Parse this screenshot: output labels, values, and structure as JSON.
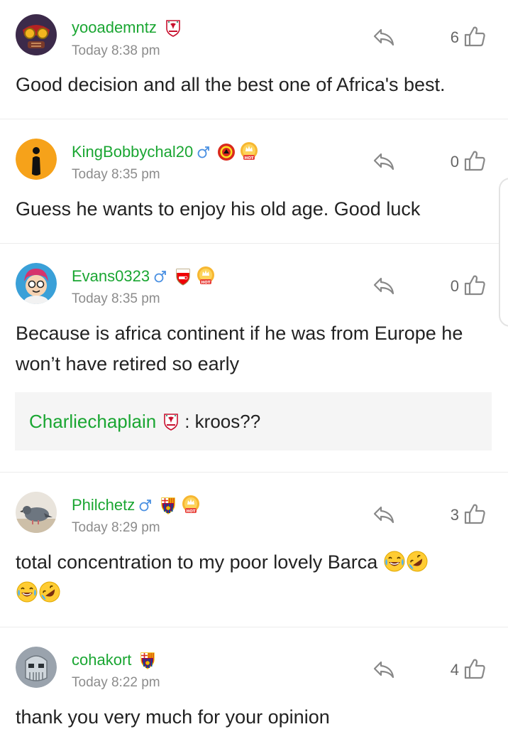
{
  "comments": [
    {
      "username": "yooademntz",
      "time": "Today 8:38 pm",
      "likes": "6",
      "text": "Good decision and all the best one of Africa's best.",
      "club_badge": "liverpool-badge-icon",
      "gender": null,
      "hot": false
    },
    {
      "username": "KingBobbychal20",
      "time": "Today 8:35 pm",
      "likes": "0",
      "text": "Guess he wants to enjoy his old age. Good luck",
      "club_badge": "manchester-united-badge-icon",
      "gender": "male",
      "hot": true
    },
    {
      "username": "Evans0323",
      "time": "Today 8:35 pm",
      "likes": "0",
      "text": "Because is africa continent if he was from Europe he won’t have retired so early",
      "club_badge": "arsenal-badge-icon",
      "gender": "male",
      "hot": true,
      "quote": {
        "username": "Charliechaplain",
        "text": ": kroos??"
      }
    },
    {
      "username": "Philchetz",
      "time": "Today 8:29 pm",
      "likes": "3",
      "text": "total concentration to my poor lovely Barca",
      "club_badge": "barcelona-badge-icon",
      "gender": "male",
      "hot": true
    },
    {
      "username": "cohakort",
      "time": "Today 8:22 pm",
      "likes": "4",
      "text": "thank you very much for your opinion",
      "club_badge": "barcelona-badge-icon",
      "gender": null,
      "hot": false
    }
  ],
  "icons": {
    "reply": "reply-arrow-icon",
    "like": "thumbs-up-icon",
    "gender_male": "male-symbol-icon",
    "hot": "hot-crown-icon",
    "laugh_emoji": "laughing-tears-emoji"
  },
  "colors": {
    "username": "#1aa632",
    "meta": "#8c8c8c",
    "text": "#222222"
  }
}
